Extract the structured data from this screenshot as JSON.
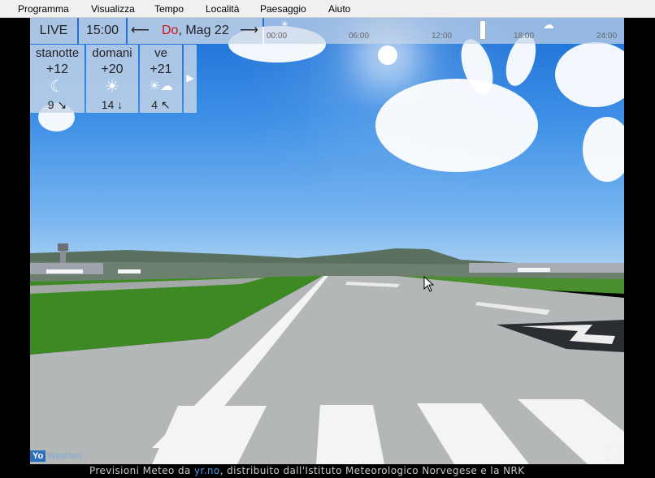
{
  "menu": [
    "Programma",
    "Visualizza",
    "Tempo",
    "Località",
    "Paesaggio",
    "Aiuto"
  ],
  "controls": {
    "live": "LIVE",
    "time": "15:00",
    "prev_arrow": "⟵",
    "next_arrow": "⟶",
    "day_prefix": "Do",
    "date_suffix": ", Mag 22"
  },
  "timeline": {
    "labels": [
      "00:00",
      "06:00",
      "12:00",
      "18:00",
      "24:00"
    ],
    "icons": [
      "sun-cloud-icon",
      "rain-icon"
    ]
  },
  "forecast": [
    {
      "day": "stanotte",
      "temp": "+12",
      "icon": "moon-icon",
      "wind": "9 ↘"
    },
    {
      "day": "domani",
      "temp": "+20",
      "icon": "sun-icon",
      "wind": "14 ↓"
    },
    {
      "day": "ve",
      "temp": "+21",
      "icon": "sun-cloud-icon",
      "wind": "4 ↖"
    }
  ],
  "forecast_more": "▶",
  "logo": {
    "yo": "Yo",
    "rest": "Weather"
  },
  "footer": {
    "prefix": "Previsioni Meteo da ",
    "link": "yr.no",
    "suffix": ", distribuito dall'Istituto Meteorologico Norvegese e la NRK"
  },
  "colors": {
    "day_accent": "#cc1a1a",
    "link": "#4b95df",
    "panel": "#c8d6e8"
  }
}
